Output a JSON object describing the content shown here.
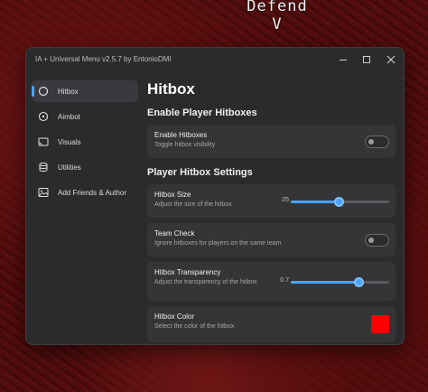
{
  "background": {
    "overlay_text_1": "Defend",
    "overlay_text_2": "V"
  },
  "window": {
    "title": "IA + Universal Menu v2.5.7  by EntonioDMI",
    "controls": [
      "minimize-icon",
      "maximize-icon",
      "close-icon"
    ]
  },
  "sidebar": {
    "items": [
      {
        "label": "Hitbox",
        "icon": "circle-icon",
        "active": true
      },
      {
        "label": "Aimbot",
        "icon": "target-icon",
        "active": false
      },
      {
        "label": "Visuals",
        "icon": "cast-icon",
        "active": false
      },
      {
        "label": "Utilities",
        "icon": "database-icon",
        "active": false
      },
      {
        "label": "Add Friends & Author",
        "icon": "image-icon",
        "active": false
      }
    ]
  },
  "main": {
    "page_title": "Hitbox",
    "section1_title": "Enable Player Hitboxes",
    "section2_title": "Player Hitbox Settings",
    "enable_hitboxes": {
      "title": "Enable Hitboxes",
      "desc": "Toggle hitbox visibility",
      "on": false
    },
    "hitbox_size": {
      "title": "Hitbox Size",
      "desc": "Adjust the size of the hitbox",
      "value": "25",
      "fraction": 0.49
    },
    "team_check": {
      "title": "Team Check",
      "desc": "Ignore hitboxes for players on the same team",
      "on": false
    },
    "hitbox_transparency": {
      "title": "Hitbox Transparency",
      "desc": "Adjust the transparency of the hitbox",
      "value": "0.7",
      "fraction": 0.69
    },
    "hitbox_color": {
      "title": "Hitbox Color",
      "desc": "Select the color of the hitbox",
      "color": "#ff0000"
    }
  },
  "colors": {
    "accent": "#4aa3ff",
    "window_bg": "#2b2b2d",
    "card_bg": "#353538"
  }
}
